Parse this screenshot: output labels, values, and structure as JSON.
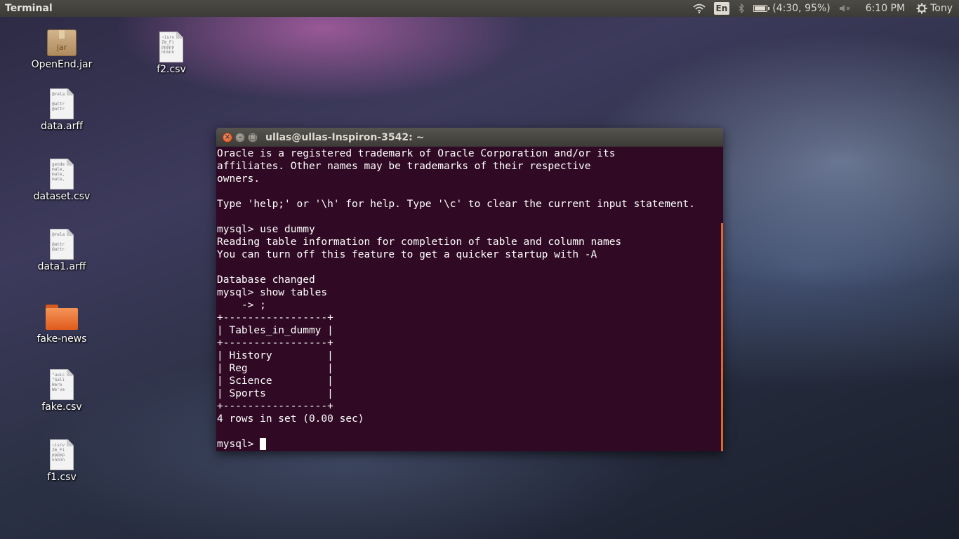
{
  "top_panel": {
    "app_title": "Terminal",
    "language": "En",
    "battery_text": "(4:30, 95%)",
    "clock": "6:10 PM",
    "user": "Tony",
    "icons": [
      "wifi-icon",
      "bluetooth-icon",
      "battery-icon",
      "volume-muted-icon",
      "gear-icon"
    ]
  },
  "desktop": {
    "icons": [
      {
        "label": "OpenEnd.jar",
        "type": "jar"
      },
      {
        "label": "f2.csv",
        "type": "text",
        "preview": [
          "~isrv",
          "Zm_Fi",
          "ppppp",
          "nnnnn"
        ]
      },
      {
        "label": "data.arff",
        "type": "text",
        "preview": [
          "@rela",
          "",
          "@attr",
          "@attr"
        ]
      },
      {
        "label": "dataset.csv",
        "type": "text",
        "preview": [
          "gende",
          "male,",
          "male,",
          "male,"
        ]
      },
      {
        "label": "data1.arff",
        "type": "text",
        "preview": [
          "@rela",
          "",
          "@attr",
          "@attr"
        ]
      },
      {
        "label": "fake-news",
        "type": "folder"
      },
      {
        "label": "fake.csv",
        "type": "text",
        "preview": [
          "\"uuic",
          "\"Gali",
          "Here",
          "We've"
        ]
      },
      {
        "label": "f1.csv",
        "type": "text",
        "preview": [
          "~isrv",
          "Zm_Fi",
          "ppppp",
          "nnnnn"
        ]
      }
    ]
  },
  "terminal": {
    "title": "ullas@ullas-Inspiron-3542: ~",
    "lines": [
      "Oracle is a registered trademark of Oracle Corporation and/or its",
      "affiliates. Other names may be trademarks of their respective",
      "owners.",
      "",
      "Type 'help;' or '\\h' for help. Type '\\c' to clear the current input statement.",
      "",
      "mysql> use dummy",
      "Reading table information for completion of table and column names",
      "You can turn off this feature to get a quicker startup with -A",
      "",
      "Database changed",
      "mysql> show tables",
      "    -> ;",
      "+-----------------+",
      "| Tables_in_dummy |",
      "+-----------------+",
      "| History         |",
      "| Reg             |",
      "| Science         |",
      "| Sports          |",
      "+-----------------+",
      "4 rows in set (0.00 sec)",
      ""
    ],
    "prompt": "mysql> "
  },
  "colors": {
    "terminal_bg": "#300a24",
    "panel_bg": "#3c3b37",
    "accent": "#e2642d"
  }
}
